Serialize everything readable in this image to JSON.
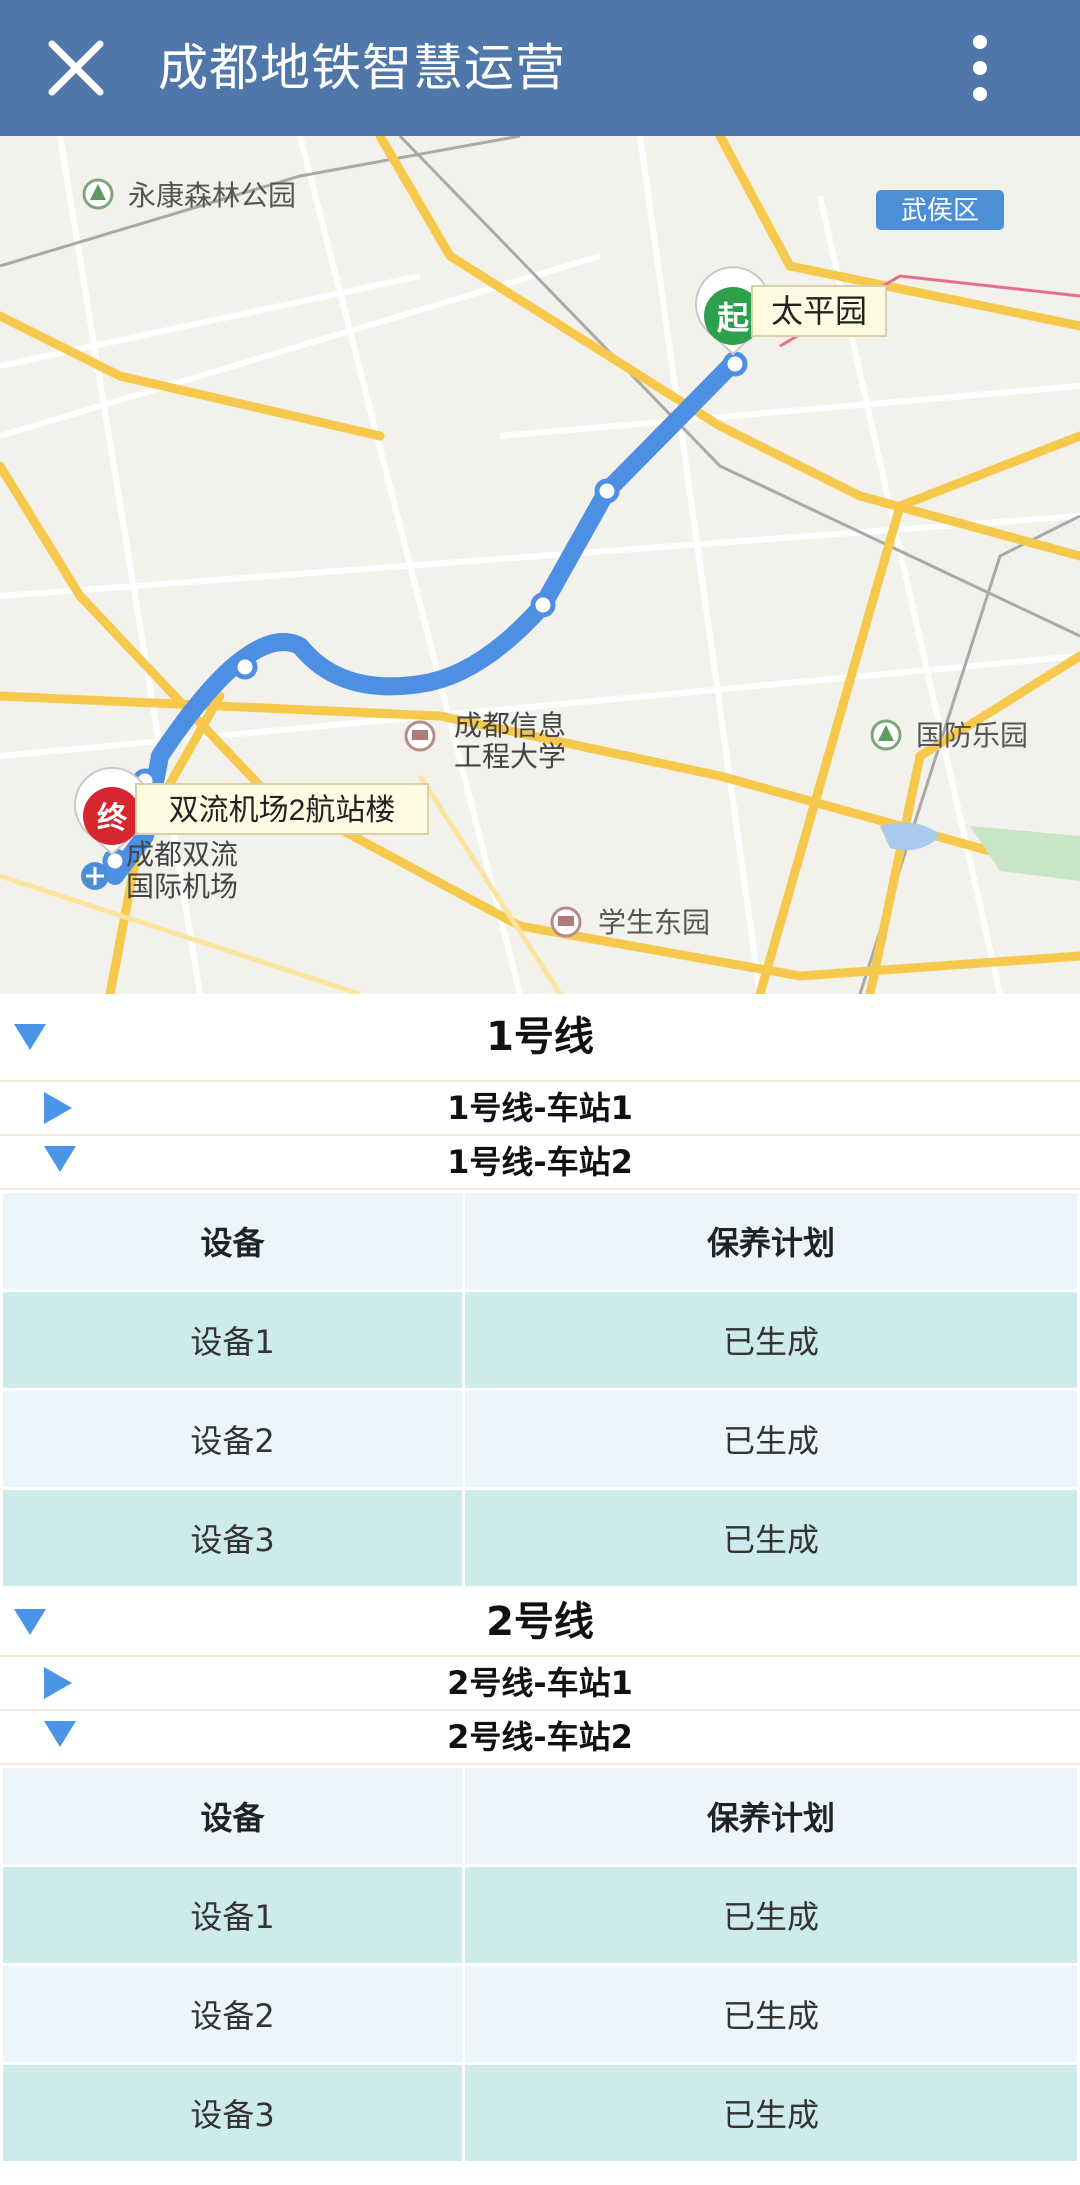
{
  "header": {
    "title": "成都地铁智慧运营",
    "close_icon": "close-icon",
    "more_icon": "more-vertical-icon",
    "bg_color": "#4f77a9"
  },
  "map": {
    "places": {
      "park_yongkang": "永康森林公园",
      "district_wuhou": "武侯区",
      "start_badge": "起",
      "start_station": "太平园",
      "end_badge": "终",
      "end_station": "双流机场2航站楼",
      "university_line1": "成都信息",
      "university_line2": "工程大学",
      "airport_line1": "成都双流",
      "airport_line2": "国际机场",
      "park_guofang": "国防乐园",
      "park_xuesheng": "学生东园"
    },
    "route_color": "#4c8fe3"
  },
  "lines": [
    {
      "name": "1号线",
      "stations": [
        {
          "name": "1号线-车站1",
          "expanded": false
        },
        {
          "name": "1号线-车站2",
          "expanded": true
        }
      ],
      "table": {
        "headers": [
          "设备",
          "保养计划"
        ],
        "rows": [
          [
            "设备1",
            "已生成"
          ],
          [
            "设备2",
            "已生成"
          ],
          [
            "设备3",
            "已生成"
          ]
        ]
      }
    },
    {
      "name": "2号线",
      "stations": [
        {
          "name": "2号线-车站1",
          "expanded": false
        },
        {
          "name": "2号线-车站2",
          "expanded": true
        }
      ],
      "table": {
        "headers": [
          "设备",
          "保养计划"
        ],
        "rows": [
          [
            "设备1",
            "已生成"
          ],
          [
            "设备2",
            "已生成"
          ],
          [
            "设备3",
            "已生成"
          ]
        ]
      }
    }
  ]
}
